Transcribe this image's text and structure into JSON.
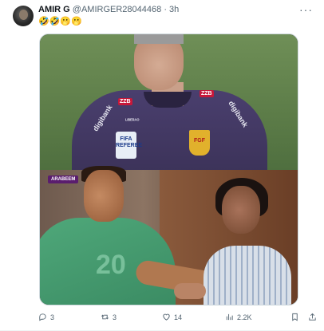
{
  "tweet": {
    "author_name": "AMIR G",
    "author_handle": "@AMIRGER28044468",
    "separator": "·",
    "time": "3h",
    "more_label": "···",
    "text": "🤣🤣🫢🫢"
  },
  "media": {
    "top": {
      "patch_fifa": "FIFA\nREFEREE",
      "patch_fpf": "FGF",
      "sponsor_1": "ZZB",
      "sponsor_2": "ZZB",
      "sponsor_3": "ᴸᴵᴮᴱᴿᴬᴼ",
      "sponsor_4": "digibank",
      "sponsor_5": "digibank"
    },
    "bottom": {
      "watermark": "ARABEEM",
      "jersey_number": "20"
    }
  },
  "actions": {
    "reply_count": "3",
    "retweet_count": "3",
    "like_count": "14",
    "views_count": "2.2K"
  },
  "colors": {
    "text_secondary": "#536471",
    "border": "#cfd9de"
  }
}
